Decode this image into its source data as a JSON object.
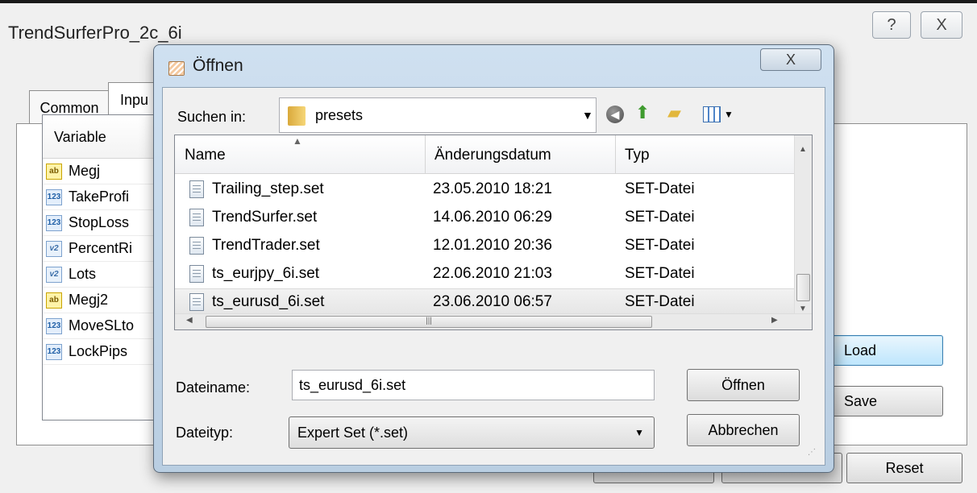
{
  "parent": {
    "title": "TrendSurferPro_2c_6i",
    "help_glyph": "?",
    "close_glyph": "X",
    "tabs": [
      {
        "label": "Common"
      },
      {
        "label": "Inpu"
      }
    ],
    "list_header": "Variable",
    "inputs": [
      {
        "icon": "ab",
        "name": "Megj"
      },
      {
        "icon": "123",
        "name": "TakeProfi"
      },
      {
        "icon": "123",
        "name": "StopLoss"
      },
      {
        "icon": "v2",
        "name": "PercentRi"
      },
      {
        "icon": "v2",
        "name": "Lots"
      },
      {
        "icon": "ab",
        "name": "Megj2"
      },
      {
        "icon": "123",
        "name": "MoveSLto"
      },
      {
        "icon": "123",
        "name": "LockPips"
      }
    ],
    "buttons": {
      "load": "Load",
      "save": "Save",
      "reset": "Reset"
    }
  },
  "dialog": {
    "title": "Öffnen",
    "close_glyph": "X",
    "look_in_label": "Suchen in:",
    "look_in_value": "presets",
    "columns": {
      "name": "Name",
      "date": "Änderungsdatum",
      "type": "Typ"
    },
    "files": [
      {
        "name": "Trailing_step.set",
        "date": "23.05.2010 18:21",
        "type": "SET-Datei",
        "selected": false
      },
      {
        "name": "TrendSurfer.set",
        "date": "14.06.2010 06:29",
        "type": "SET-Datei",
        "selected": false
      },
      {
        "name": "TrendTrader.set",
        "date": "12.01.2010 20:36",
        "type": "SET-Datei",
        "selected": false
      },
      {
        "name": "ts_eurjpy_6i.set",
        "date": "22.06.2010 21:03",
        "type": "SET-Datei",
        "selected": false
      },
      {
        "name": "ts_eurusd_6i.set",
        "date": "23.06.2010 06:57",
        "type": "SET-Datei",
        "selected": true
      }
    ],
    "file_name_label": "Dateiname:",
    "file_name_value": "ts_eurusd_6i.set",
    "file_type_label": "Dateityp:",
    "file_type_value": "Expert Set (*.set)",
    "open_button": "Öffnen",
    "cancel_button": "Abbrechen",
    "icons": {
      "back": "back-icon",
      "up": "up-folder-icon",
      "new_folder": "new-folder-icon",
      "views": "views-menu-icon"
    }
  }
}
